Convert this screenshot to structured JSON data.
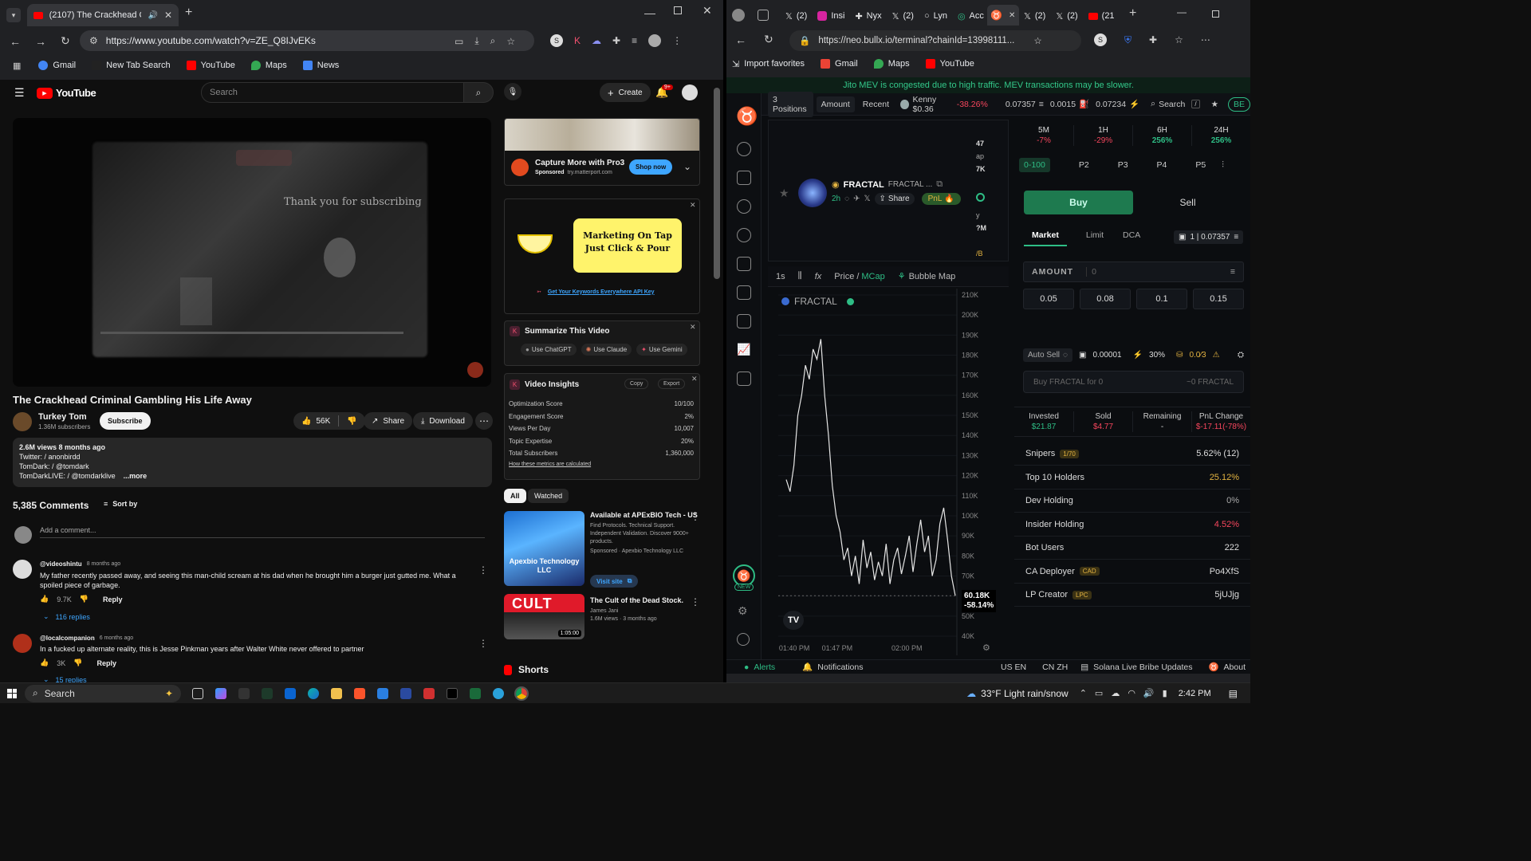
{
  "left_browser": {
    "tab_title": "(2107) The Crackhead Crimi",
    "url": "https://www.youtube.com/watch?v=ZE_Q8IJvEKs",
    "bookmarks": [
      "Gmail",
      "New Tab Search",
      "YouTube",
      "Maps",
      "News"
    ]
  },
  "youtube": {
    "logo": "YouTube",
    "search_placeholder": "Search",
    "create_label": "Create",
    "notif_count": "9+",
    "player_overlay_text": "Thank you for subscribing",
    "video_title": "The Crackhead Criminal Gambling His Life Away",
    "channel": "Turkey Tom",
    "subscribers": "1.36M subscribers",
    "subscribe_label": "Subscribe",
    "likes": "56K",
    "share_label": "Share",
    "download_label": "Download",
    "desc_stats": "2.6M views  8 months ago",
    "desc_lines": [
      "Twitter:  / anonbirdd",
      "TomDark:  / @tomdark",
      "TomDarkLIVE:  / @tomdarklive"
    ],
    "more_label": "...more",
    "comments_count": "5,385 Comments",
    "sort_label": "Sort by",
    "add_comment": "Add a comment...",
    "comments": [
      {
        "author": "@videoshintu",
        "time": "8 months ago",
        "text": "My father recently passed away, and seeing this man-child scream at his dad when he brought him a burger just gutted me. What a spoiled piece of garbage.",
        "likes": "9.7K",
        "reply": "Reply",
        "replies": "116 replies"
      },
      {
        "author": "@localcompanion",
        "time": "6 months ago",
        "text": "In a fucked up alternate reality, this is Jesse Pinkman years after Walter White never offered to partner",
        "likes": "3K",
        "reply": "Reply",
        "replies": "15 replies"
      }
    ],
    "ad1": {
      "title": "Capture More with Pro3",
      "sponsored": "Sponsored",
      "domain": "try.matterport.com",
      "cta": "Shop now"
    },
    "ad2": {
      "headline": "Marketing On Tap Just Click & Pour",
      "link": "Get Your Keywords Everywhere API Key"
    },
    "summarize": {
      "title": "Summarize This Video",
      "chatgpt": "Use ChatGPT",
      "claude": "Use Claude",
      "gemini": "Use Gemini"
    },
    "insights": {
      "title": "Video Insights",
      "copy": "Copy",
      "export": "Export",
      "rows": [
        [
          "Optimization Score",
          "10/100"
        ],
        [
          "Engagement Score",
          "2%"
        ],
        [
          "Views Per Day",
          "10,007"
        ],
        [
          "Topic Expertise",
          "20%"
        ],
        [
          "Total Subscribers",
          "1,360,000"
        ]
      ],
      "link": "How these metrics are calculated"
    },
    "filter_all": "All",
    "filter_watched": "Watched",
    "rec1": {
      "title": "Available at APExBIO Tech - US",
      "desc": "Find Protocols. Technical Support. Independent Validation. Discover 9000+ products.",
      "meta": "Sponsored · Apexbio Technology LLC",
      "thumb_text": "Apexbio Technology LLC",
      "cta": "Visit site"
    },
    "rec2": {
      "title": "The Cult of the Dead Stock.",
      "channel": "James Jani",
      "meta": "1.6M views · 3 months ago",
      "duration": "1:05:00",
      "thumb_text": "CULT"
    },
    "shorts": "Shorts"
  },
  "right_browser": {
    "tabs": [
      "(2)",
      "Insi",
      "Nyx",
      "(2)",
      "Lyn",
      "Acc",
      "(2)",
      "(2)",
      "(21"
    ],
    "url": "https://neo.bullx.io/terminal?chainId=13998111...",
    "bookmarks": [
      "Import favorites",
      "Gmail",
      "Maps",
      "YouTube"
    ]
  },
  "bullx": {
    "banner": "Jito MEV is congested due to high traffic. MEV transactions may be slower.",
    "top": {
      "positions": "3 Positions",
      "amount": "Amount",
      "recent": "Recent",
      "kenny": "Kenny $0.36",
      "kenny_change": "-38.26%",
      "p1": "0.07357",
      "p2": "0.0015",
      "p3": "0.07234",
      "search": "Search",
      "chain": "BE"
    },
    "token": {
      "name": "FRACTAL",
      "ticker": "FRACTAL ...",
      "age": "2h",
      "share": "Share",
      "pnl": "PnL"
    },
    "chart_toolbar": {
      "interval": "1s",
      "price": "Price",
      "mcap": "MCap",
      "bubble": "Bubble Map"
    },
    "chart_label": "FRACTAL",
    "last_value": "60.18K",
    "last_change": "-58.14%",
    "side_values": [
      "47",
      "ap",
      "7K",
      "y",
      "?M",
      "/B"
    ],
    "timeframes": [
      {
        "label": "5M",
        "change": "-7%",
        "color": "#f6465d"
      },
      {
        "label": "1H",
        "change": "-29%",
        "color": "#f6465d"
      },
      {
        "label": "6H",
        "change": "256%",
        "color": "#2ebd85"
      },
      {
        "label": "24H",
        "change": "256%",
        "color": "#2ebd85"
      }
    ],
    "presets": [
      "0-100",
      "P2",
      "P3",
      "P4",
      "P5"
    ],
    "buy": "Buy",
    "sell": "Sell",
    "order_tabs": [
      "Market",
      "Limit",
      "DCA"
    ],
    "order_info": "1 | 0.07357",
    "amount_label": "AMOUNT",
    "amount_value": "0",
    "quick": [
      "0.05",
      "0.08",
      "0.1",
      "0.15"
    ],
    "auto_sell": "Auto Sell",
    "fee": "0.00001",
    "slip": "30%",
    "tip": "0.0⁄3",
    "buy_placeholder": "Buy FRACTAL for 0",
    "receive": "~0 FRACTAL",
    "stats": [
      {
        "label": "Invested",
        "value": "$21.87",
        "color": "#2ebd85"
      },
      {
        "label": "Sold",
        "value": "$4.77",
        "color": "#f6465d"
      },
      {
        "label": "Remaining",
        "value": "-",
        "color": "#ddd"
      },
      {
        "label": "PnL Change",
        "value": "$-17.11(-78%)",
        "color": "#f6465d"
      }
    ],
    "holders": [
      {
        "label": "Snipers",
        "tag": "1/70",
        "value": "5.62% (12)",
        "color": "#ddd"
      },
      {
        "label": "Top 10 Holders",
        "tag": "",
        "value": "25.12%",
        "color": "#e3b341"
      },
      {
        "label": "Dev Holding",
        "tag": "",
        "value": "0%",
        "color": "#aaa"
      },
      {
        "label": "Insider Holding",
        "tag": "",
        "value": "4.52%",
        "color": "#f6465d"
      },
      {
        "label": "Bot Users",
        "tag": "",
        "value": "222",
        "color": "#ddd"
      },
      {
        "label": "CA Deployer",
        "tag": "CAD",
        "value": "Po4XfS",
        "color": "#ddd"
      },
      {
        "label": "LP Creator",
        "tag": "LPC",
        "value": "5jUJjg",
        "color": "#ddd"
      }
    ],
    "footer": {
      "alerts": "Alerts",
      "notifications": "Notifications",
      "lang1": "US EN",
      "lang2": "CN ZH",
      "news": "Solana Live Bribe Updates",
      "about": "About"
    },
    "new_badge": "NEW"
  },
  "chart_data": {
    "type": "line",
    "title": "FRACTAL",
    "x_ticks": [
      "01:40 PM",
      "01:47 PM",
      "02:00 PM"
    ],
    "y_ticks": [
      "210K",
      "200K",
      "190K",
      "180K",
      "170K",
      "160K",
      "150K",
      "140K",
      "130K",
      "120K",
      "110K",
      "100K",
      "90K",
      "80K",
      "70K",
      "60K",
      "50K",
      "40K"
    ],
    "ylim": [
      40000,
      210000
    ],
    "series": [
      {
        "values": [
          118000,
          112000,
          125000,
          150000,
          160000,
          175000,
          168000,
          183000,
          178000,
          188000,
          160000,
          140000,
          115000,
          100000,
          92000,
          78000,
          84000,
          70000,
          80000,
          66000,
          88000,
          74000,
          82000,
          68000,
          77000,
          70000,
          86000,
          66000,
          78000,
          84000,
          71000,
          80000,
          90000,
          72000,
          86000,
          98000,
          82000,
          90000,
          70000,
          78000,
          96000,
          104000,
          88000,
          70000,
          60180
        ]
      }
    ]
  },
  "taskbar": {
    "search": "Search",
    "weather": "33°F  Light rain/snow",
    "time": "2:42 PM"
  }
}
